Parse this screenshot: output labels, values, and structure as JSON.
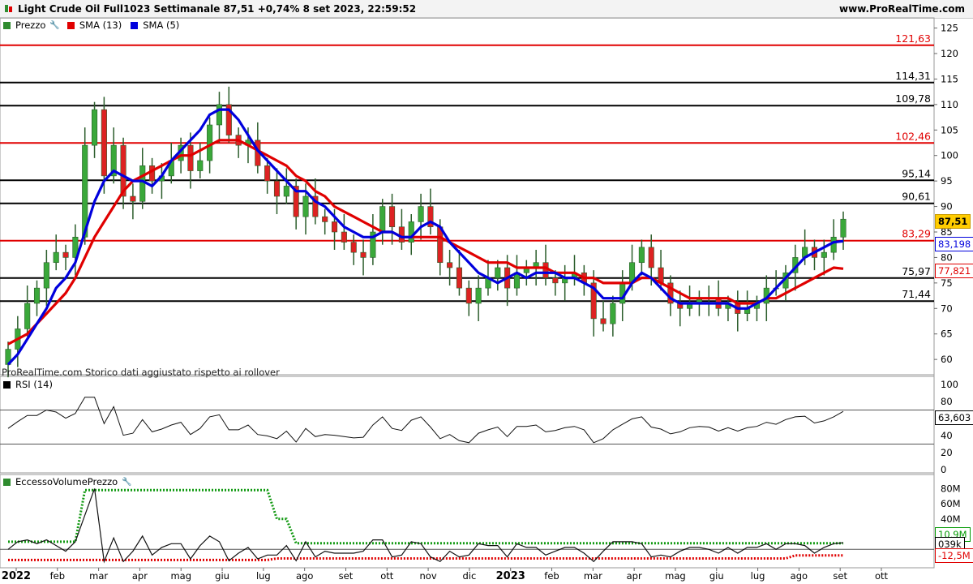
{
  "header": {
    "title": "Light Crude Oil Full1023 Settimanale 87,51 +0,74% 8 set 2023, 22:59:52",
    "site": "www.ProRealTime.com"
  },
  "price_pane": {
    "legend": [
      {
        "label": "Prezzo",
        "color": "#2e8b2e"
      },
      {
        "label": "SMA (13)",
        "color": "#e00000"
      },
      {
        "label": "SMA (5)",
        "color": "#0000dd"
      }
    ],
    "note": "ProRealTime.com Storico dati aggiustato rispetto ai rollover",
    "last_price_tag": "87,51",
    "sma5_tag": "83,198",
    "sma13_tag": "77,821",
    "levels": [
      {
        "label": "121,63",
        "value": 121.63,
        "color": "#e00000"
      },
      {
        "label": "114,31",
        "value": 114.31,
        "color": "#000000"
      },
      {
        "label": "109,78",
        "value": 109.78,
        "color": "#000000"
      },
      {
        "label": "102,46",
        "value": 102.46,
        "color": "#e00000"
      },
      {
        "label": "95,14",
        "value": 95.14,
        "color": "#000000"
      },
      {
        "label": "90,61",
        "value": 90.61,
        "color": "#000000"
      },
      {
        "label": "83,29",
        "value": 83.29,
        "color": "#e00000"
      },
      {
        "label": "75,97",
        "value": 75.97,
        "color": "#000000"
      },
      {
        "label": "71,44",
        "value": 71.44,
        "color": "#000000"
      }
    ],
    "yticks": [
      "60",
      "65",
      "70",
      "75",
      "80",
      "85",
      "90",
      "95",
      "100",
      "105",
      "110",
      "115",
      "120",
      "125"
    ]
  },
  "rsi_pane": {
    "legend": "RSI (14)",
    "tag": "63,603",
    "yticks": [
      "0",
      "20",
      "40",
      "60",
      "80",
      "100"
    ]
  },
  "volume_pane": {
    "legend": "EccessoVolumePrezzo",
    "tags": [
      "10,9M",
      "039k",
      "-12,5M"
    ],
    "yticks": [
      "0",
      "20M",
      "40M",
      "60M",
      "80M"
    ]
  },
  "xaxis": {
    "labels": [
      "2022",
      "feb",
      "mar",
      "apr",
      "mag",
      "giu",
      "lug",
      "ago",
      "set",
      "ott",
      "nov",
      "dic",
      "2023",
      "feb",
      "mar",
      "apr",
      "mag",
      "giu",
      "lug",
      "ago",
      "set",
      "ott"
    ]
  },
  "chart_data": {
    "type": "candlestick",
    "title": "Light Crude Oil Full1023 Settimanale",
    "y_range": [
      57,
      127
    ],
    "x": [
      "2022-01-03",
      "2022-01-10",
      "2022-01-17",
      "2022-01-24",
      "2022-01-31",
      "2022-02-07",
      "2022-02-14",
      "2022-02-21",
      "2022-02-28",
      "2022-03-07",
      "2022-03-14",
      "2022-03-21",
      "2022-03-28",
      "2022-04-04",
      "2022-04-11",
      "2022-04-18",
      "2022-04-25",
      "2022-05-02",
      "2022-05-09",
      "2022-05-16",
      "2022-05-23",
      "2022-05-30",
      "2022-06-06",
      "2022-06-13",
      "2022-06-20",
      "2022-06-27",
      "2022-07-04",
      "2022-07-11",
      "2022-07-18",
      "2022-07-25",
      "2022-08-01",
      "2022-08-08",
      "2022-08-15",
      "2022-08-22",
      "2022-08-29",
      "2022-09-05",
      "2022-09-12",
      "2022-09-19",
      "2022-09-26",
      "2022-10-03",
      "2022-10-10",
      "2022-10-17",
      "2022-10-24",
      "2022-10-31",
      "2022-11-07",
      "2022-11-14",
      "2022-11-21",
      "2022-11-28",
      "2022-12-05",
      "2022-12-12",
      "2022-12-19",
      "2022-12-26",
      "2023-01-02",
      "2023-01-09",
      "2023-01-16",
      "2023-01-23",
      "2023-01-30",
      "2023-02-06",
      "2023-02-13",
      "2023-02-20",
      "2023-02-27",
      "2023-03-06",
      "2023-03-13",
      "2023-03-20",
      "2023-03-27",
      "2023-04-03",
      "2023-04-10",
      "2023-04-17",
      "2023-04-24",
      "2023-05-01",
      "2023-05-08",
      "2023-05-15",
      "2023-05-22",
      "2023-05-29",
      "2023-06-05",
      "2023-06-12",
      "2023-06-19",
      "2023-06-26",
      "2023-07-03",
      "2023-07-10",
      "2023-07-17",
      "2023-07-24",
      "2023-07-31",
      "2023-08-07",
      "2023-08-14",
      "2023-08-21",
      "2023-08-28",
      "2023-09-04"
    ],
    "close": [
      62,
      66,
      71,
      74,
      79,
      81,
      80,
      84,
      102,
      109,
      96,
      102,
      92,
      91,
      98,
      95,
      96,
      99,
      102,
      97,
      99,
      106,
      110,
      104,
      102,
      103,
      98,
      95,
      92,
      94,
      88,
      92,
      88,
      87,
      85,
      83,
      81,
      80,
      85,
      90,
      86,
      83,
      87,
      90,
      86,
      79,
      78,
      74,
      71,
      74,
      76,
      78,
      74,
      77,
      78,
      79,
      76,
      75,
      76,
      77,
      75,
      68,
      67,
      71,
      75,
      79,
      82,
      78,
      75,
      71,
      70,
      71,
      72,
      72,
      70,
      71,
      69,
      70,
      71,
      74,
      74,
      77,
      80,
      82,
      80,
      81,
      84,
      87.51
    ],
    "sma5": [
      59,
      61,
      64,
      67,
      70,
      74,
      76,
      79,
      85,
      91,
      95,
      97,
      96,
      95,
      95,
      94,
      96,
      99,
      101,
      103,
      105,
      108,
      109,
      109,
      107,
      104,
      101,
      99,
      97,
      95,
      93,
      93,
      91,
      90,
      88,
      86,
      85,
      84,
      84,
      85,
      85,
      84,
      84,
      86,
      87,
      86,
      83,
      81,
      79,
      77,
      76,
      75,
      76,
      77,
      76,
      77,
      77,
      77,
      76,
      76,
      75,
      74,
      72,
      72,
      72,
      75,
      77,
      76,
      74,
      72,
      71,
      71,
      71,
      71,
      71,
      71,
      70,
      70,
      71,
      72,
      74,
      76,
      78,
      80,
      81,
      82,
      83,
      83.2
    ],
    "sma13": [
      63,
      64,
      65,
      67,
      69,
      71,
      73,
      76,
      80,
      84,
      87,
      90,
      93,
      95,
      96,
      97,
      98,
      99,
      100,
      100,
      101,
      102,
      103,
      103,
      103,
      102,
      101,
      100,
      99,
      98,
      96,
      95,
      93,
      92,
      90,
      89,
      88,
      87,
      86,
      85,
      85,
      84,
      84,
      84,
      84,
      84,
      83,
      82,
      81,
      80,
      79,
      79,
      79,
      78,
      78,
      78,
      78,
      77,
      77,
      77,
      76,
      76,
      75,
      75,
      75,
      75,
      76,
      76,
      75,
      74,
      73,
      72,
      72,
      72,
      72,
      72,
      71,
      71,
      71,
      72,
      72,
      73,
      74,
      75,
      76,
      77,
      78,
      77.8
    ],
    "rsi_range": [
      0,
      100
    ],
    "volume_range": [
      -20,
      90
    ]
  }
}
